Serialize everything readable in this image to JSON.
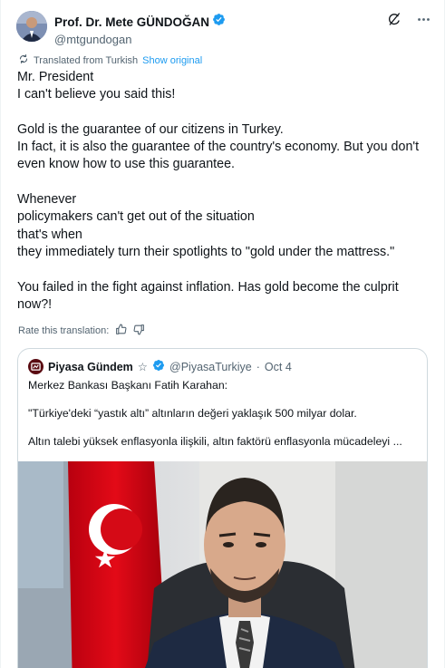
{
  "author": {
    "display_name": "Prof. Dr. Mete GÜNDOĞAN",
    "handle": "@mtgundogan",
    "verified_color": "#1d9bf0"
  },
  "header_actions": [
    "grok-icon",
    "more-icon"
  ],
  "translation": {
    "notice": "Translated from Turkish",
    "show_original": "Show original"
  },
  "tweet_text": "Mr. President\nI can't believe you said this!\n\nGold is the guarantee of our citizens in Turkey.\nIn fact, it is also the guarantee of the country's economy. But you don't even know how to use this guarantee.\n\nWhenever\npolicymakers can't get out of the situation\nthat's when\nthey immediately turn their spotlights to \"gold under the mattress.\"\n\nYou failed in the fight against inflation. Has gold become the culprit now?!",
  "rate": {
    "label": "Rate this translation:"
  },
  "quote": {
    "display_name": "Piyasa Gündem",
    "star": "☆",
    "handle": "@PiyasaTurkiye",
    "separator": "·",
    "date": "Oct 4",
    "text": "Merkez Bankası Başkanı Fatih Karahan:\n\n\"Türkiye'deki “yastık altı” altınların değeri yaklaşık 500 milyar dolar.\n\nAltın talebi yüksek enflasyonla ilişkili, altın faktörü enflasyonla mücadeleyi ..."
  },
  "colors": {
    "text_primary": "#0f1419",
    "text_secondary": "#536471",
    "link": "#1d9bf0",
    "border": "#cfd9de",
    "flag_red": "#e30a17"
  }
}
